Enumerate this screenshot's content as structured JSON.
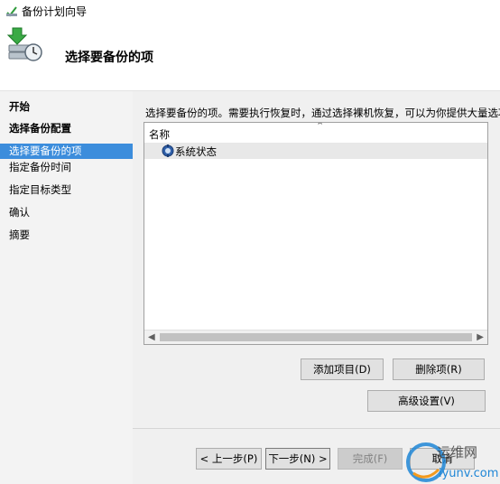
{
  "window": {
    "title": "备份计划向导",
    "icon": "backup-wizard-icon"
  },
  "header": {
    "title": "选择要备份的项",
    "icon": "backup-server-icon"
  },
  "nav": {
    "items": [
      {
        "label": "开始",
        "bold": true,
        "selected": false
      },
      {
        "label": "选择备份配置",
        "bold": true,
        "selected": false
      },
      {
        "label": "选择要备份的项",
        "bold": false,
        "selected": true
      },
      {
        "label": "指定备份时间",
        "bold": false,
        "selected": false
      },
      {
        "label": "指定目标类型",
        "bold": false,
        "selected": false
      },
      {
        "label": "确认",
        "bold": false,
        "selected": false
      },
      {
        "label": "摘要",
        "bold": false,
        "selected": false
      }
    ]
  },
  "main": {
    "description": "选择要备份的项。需要执行恢复时，通过选择裸机恢复，可以为你提供大量选项。",
    "list": {
      "column_header": "名称",
      "rows": [
        {
          "label": "系统状态",
          "icon": "system-state-icon"
        }
      ]
    },
    "buttons": {
      "add_items": "添加项目(D)",
      "remove_items": "删除项(R)",
      "advanced": "高级设置(V)"
    }
  },
  "footer": {
    "prev": "< 上一步(P)",
    "next": "下一步(N) >",
    "finish": "完成(F)",
    "cancel": "取消"
  },
  "watermark": {
    "line1": "运维网",
    "line2": "iyunv.com"
  },
  "colors": {
    "selection": "#3c8ddc",
    "nav_bg": "#f3f3f3",
    "content_bg": "#f0f0f0"
  }
}
